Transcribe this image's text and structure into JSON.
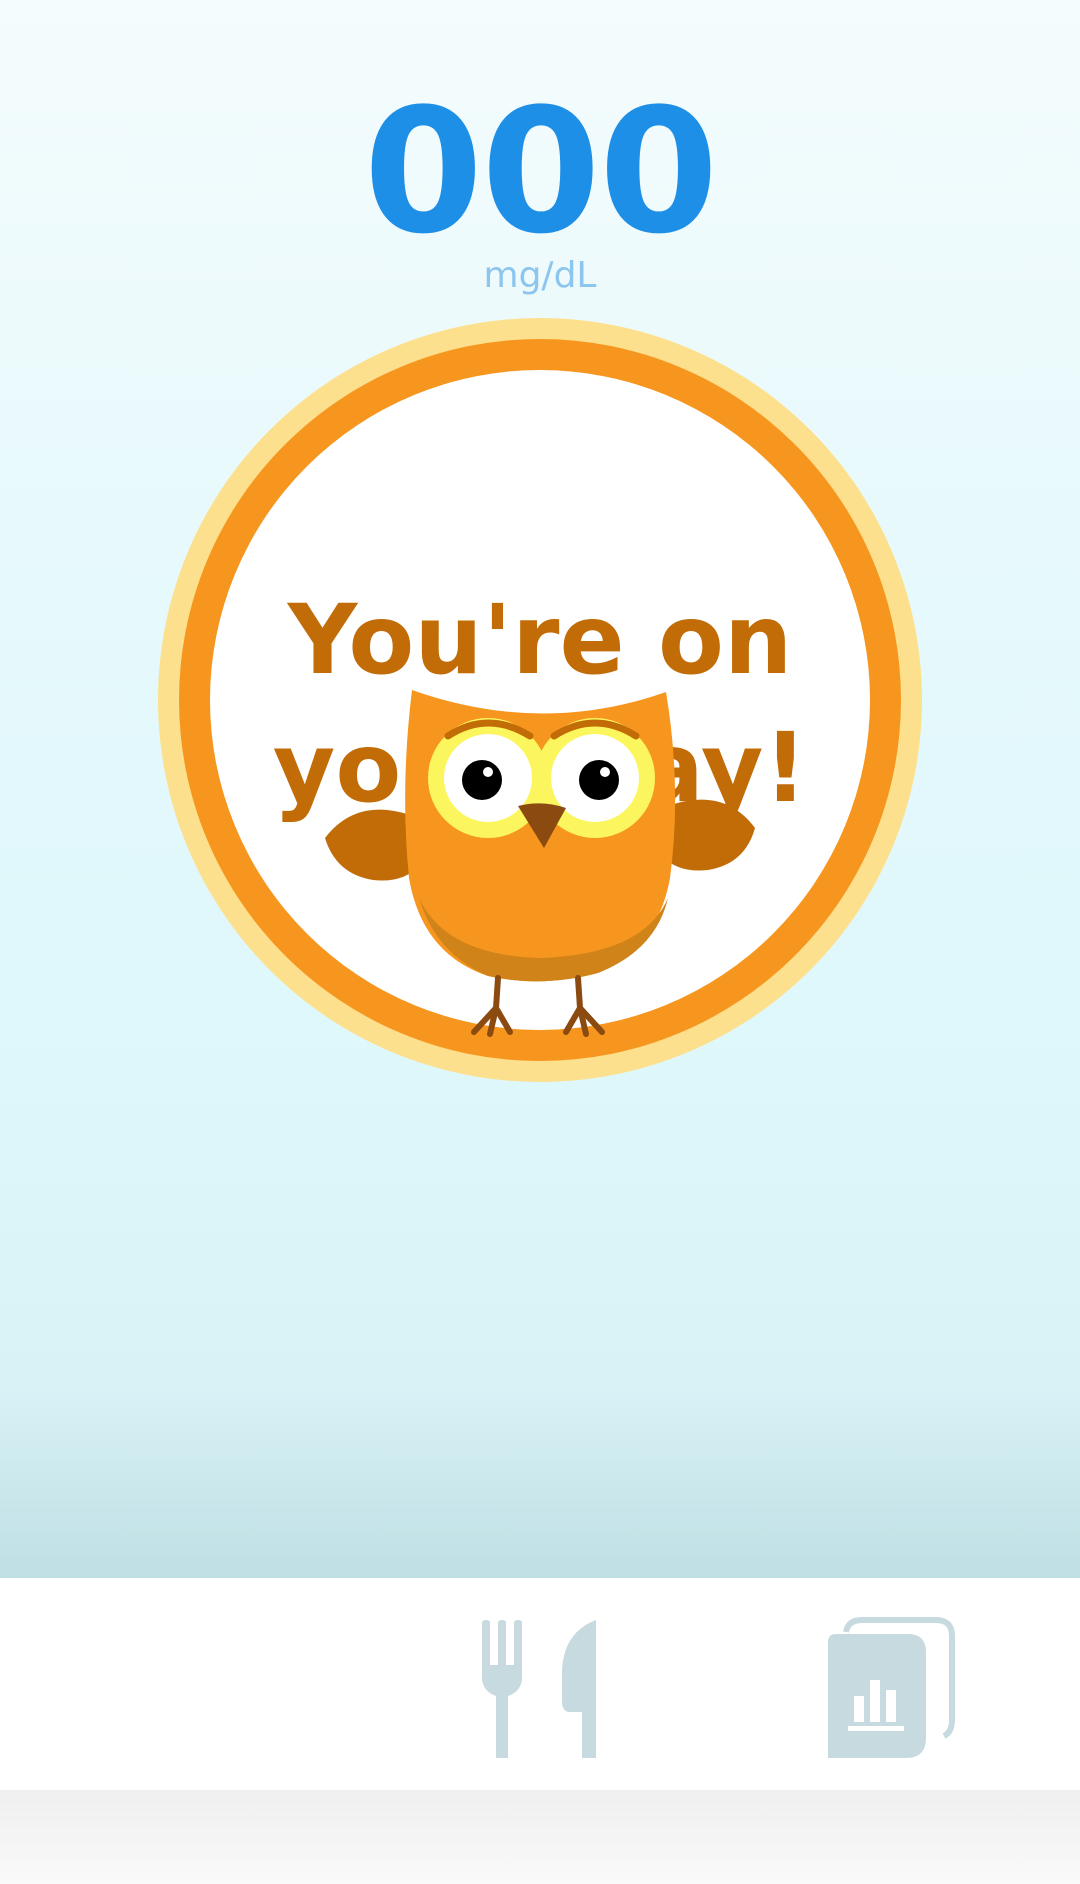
{
  "reading": {
    "value": "000",
    "unit": "mg/dL"
  },
  "badge": {
    "message": "You're on your way!",
    "mascot_icon": "owl-mascot"
  },
  "nav": {
    "items": [
      {
        "icon": "fork-knife-icon"
      },
      {
        "icon": "report-chart-icon"
      }
    ]
  },
  "colors": {
    "reading_value": "#1e8fe6",
    "reading_unit": "#8cc6ee",
    "badge_ring": "#f7961e",
    "badge_halo": "#fde08e",
    "message": "#c16c06",
    "nav_icon": "#c7dadf"
  }
}
